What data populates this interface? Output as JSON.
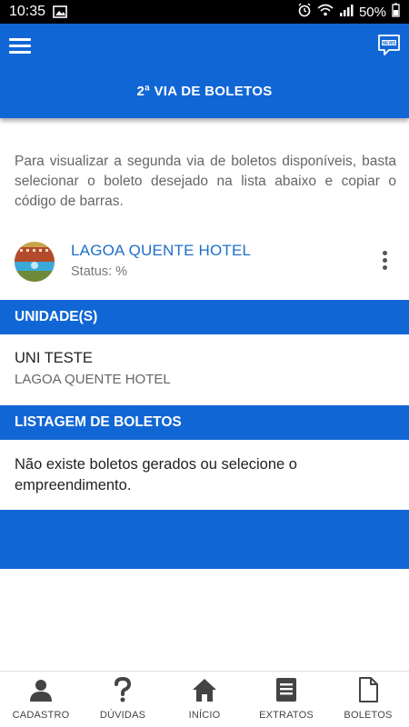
{
  "status_bar": {
    "time": "10:35",
    "battery": "50%"
  },
  "header": {
    "title": "2ª VIA DE BOLETOS"
  },
  "intro_text": "Para visualizar a segunda via de boletos disponíveis, basta selecionar o boleto desejado na lista abaixo e copiar o código de barras.",
  "venture": {
    "name": "LAGOA QUENTE HOTEL",
    "status": "Status: %"
  },
  "units_section": {
    "title": "UNIDADE(S)",
    "unit_name": "UNI TESTE",
    "unit_venture": "LAGOA QUENTE HOTEL"
  },
  "boletos_section": {
    "title": "LISTAGEM DE BOLETOS",
    "empty_message": "Não existe boletos gerados ou selecione o empreendimento."
  },
  "bottom_nav": [
    {
      "label": "CADASTRO",
      "icon": "user-icon"
    },
    {
      "label": "DÚVIDAS",
      "icon": "question-icon"
    },
    {
      "label": "INÍCIO",
      "icon": "home-icon"
    },
    {
      "label": "EXTRATOS",
      "icon": "document-list-icon"
    },
    {
      "label": "BOLETOS",
      "icon": "file-icon"
    }
  ],
  "colors": {
    "primary": "#1166d6",
    "link": "#1e6fc8",
    "status_bar": "#000000"
  }
}
